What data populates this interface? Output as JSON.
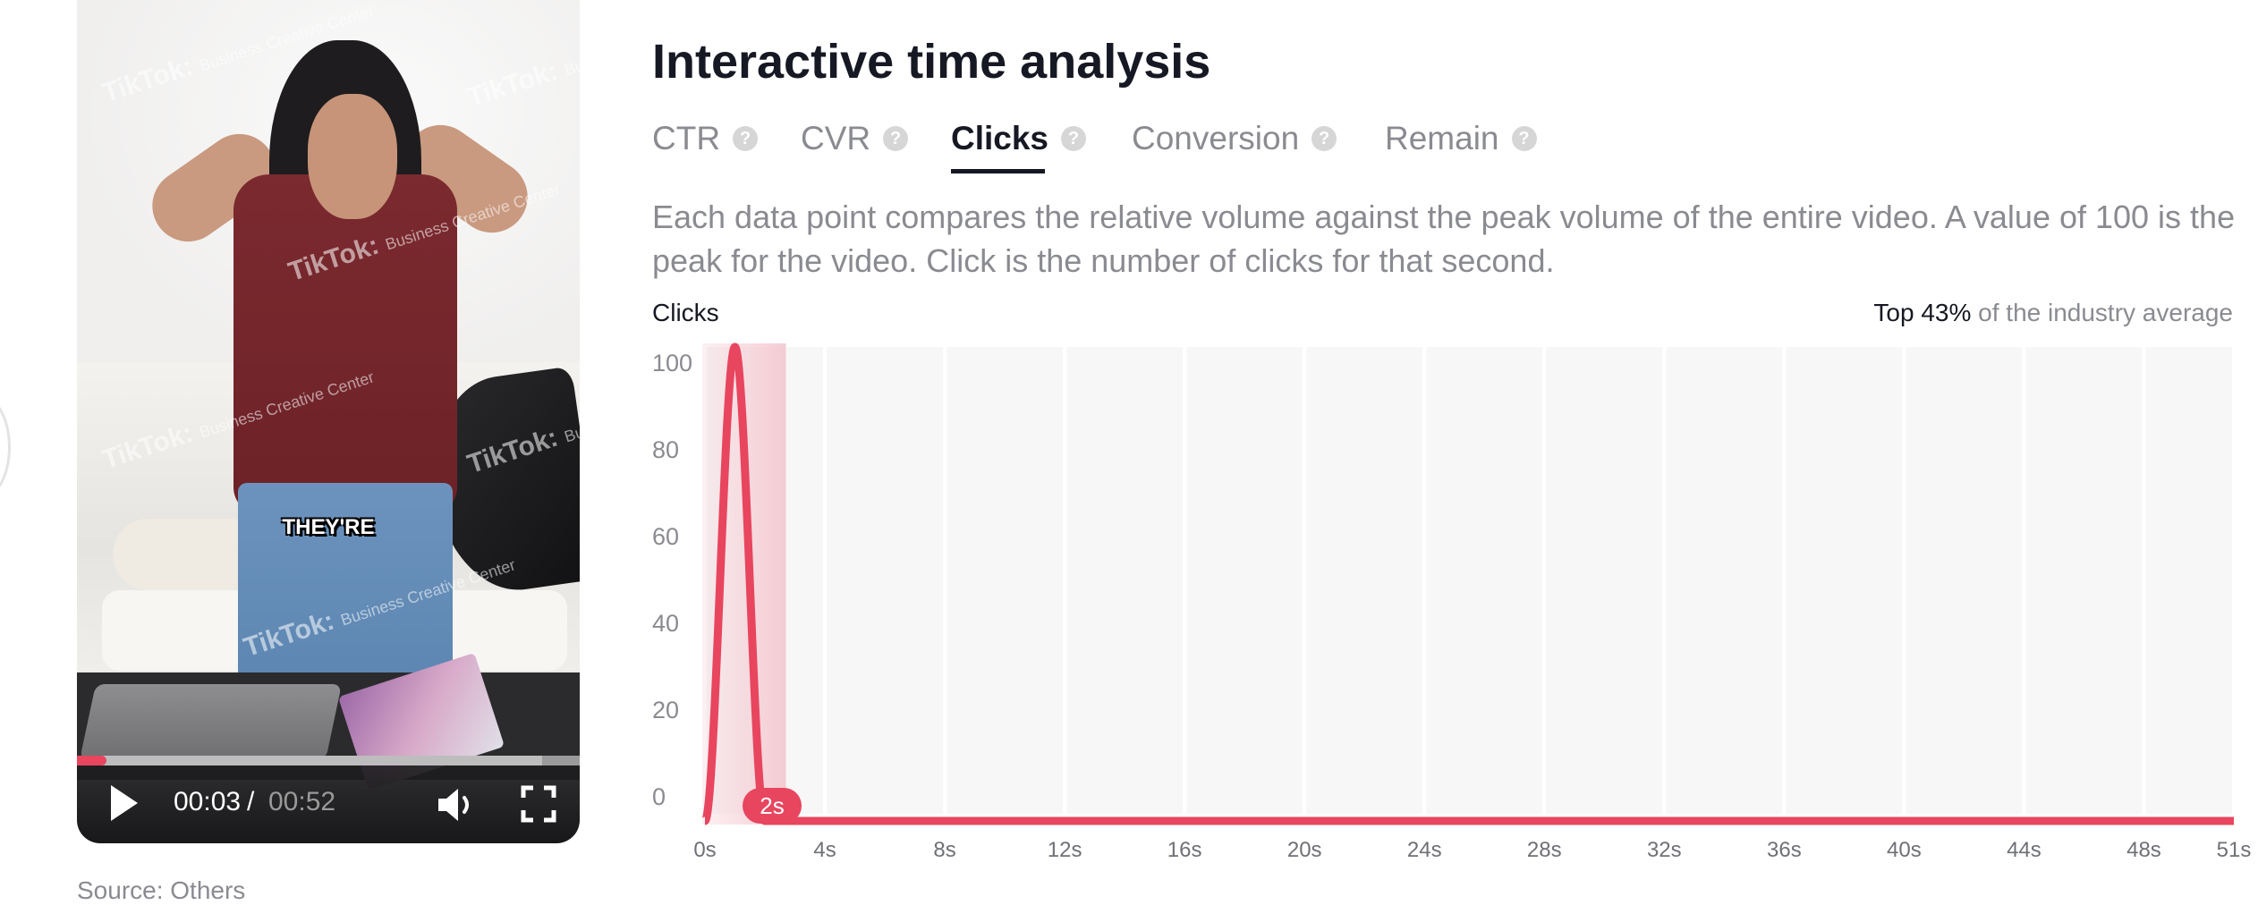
{
  "video": {
    "subtitle": "THEY'RE",
    "watermark_brand": "TikTok:",
    "watermark_text": "Business Creative Center",
    "time_current": "00:03",
    "time_separator": "/",
    "time_total": "00:52",
    "progress_fraction": 0.058,
    "controls": {
      "play": "play-icon",
      "volume": "volume-icon",
      "fullscreen": "fullscreen-icon"
    }
  },
  "source": "Source: Others",
  "panel": {
    "title": "Interactive time analysis",
    "tabs": [
      {
        "label": "CTR",
        "active": false
      },
      {
        "label": "CVR",
        "active": false
      },
      {
        "label": "Clicks",
        "active": true
      },
      {
        "label": "Conversion",
        "active": false
      },
      {
        "label": "Remain",
        "active": false
      }
    ],
    "help_glyph": "?",
    "description": "Each data point compares the relative volume against the peak volume of the entire video. A value of 100 is the peak for the video. Click is the number of clicks for that second.",
    "chart_label": "Clicks",
    "industry_strong": "Top 43%",
    "industry_rest": " of the industry average"
  },
  "colors": {
    "accent": "#e8455f",
    "highlight": "#f4c7cf",
    "grid_fill": "#f7f7f7",
    "text_primary": "#161823",
    "text_secondary": "#8a8b91"
  },
  "chart_data": {
    "type": "line",
    "title": "Clicks",
    "xlabel": "",
    "ylabel": "Clicks",
    "ylim": [
      0,
      100
    ],
    "xlim": [
      0,
      51
    ],
    "y_ticks": [
      0,
      20,
      40,
      60,
      80,
      100
    ],
    "x_ticks": [
      0,
      4,
      8,
      12,
      16,
      20,
      24,
      28,
      32,
      36,
      40,
      44,
      48,
      51
    ],
    "x_tick_labels": [
      "0s",
      "4s",
      "8s",
      "12s",
      "16s",
      "20s",
      "24s",
      "28s",
      "32s",
      "36s",
      "40s",
      "44s",
      "48s",
      "51s"
    ],
    "series": [
      {
        "name": "Clicks",
        "x": [
          0,
          1,
          2,
          3,
          4,
          5,
          6,
          7,
          8,
          9,
          10,
          11,
          12,
          13,
          14,
          15,
          16,
          17,
          18,
          19,
          20,
          21,
          22,
          23,
          24,
          25,
          26,
          27,
          28,
          29,
          30,
          31,
          32,
          33,
          34,
          35,
          36,
          37,
          38,
          39,
          40,
          41,
          42,
          43,
          44,
          45,
          46,
          47,
          48,
          49,
          50,
          51
        ],
        "values": [
          0,
          100,
          0,
          0,
          0,
          0,
          0,
          0,
          0,
          0,
          0,
          0,
          0,
          0,
          0,
          0,
          0,
          0,
          0,
          0,
          0,
          0,
          0,
          0,
          0,
          0,
          0,
          0,
          0,
          0,
          0,
          0,
          0,
          0,
          0,
          0,
          0,
          0,
          0,
          0,
          0,
          0,
          0,
          0,
          0,
          0,
          0,
          0,
          0,
          0,
          0,
          0
        ]
      }
    ],
    "highlight_range": [
      0,
      2.7
    ],
    "marker": {
      "x": 2,
      "label": "2s"
    },
    "grid": true,
    "legend": "none",
    "annotation": "Top 43% of the industry average"
  }
}
